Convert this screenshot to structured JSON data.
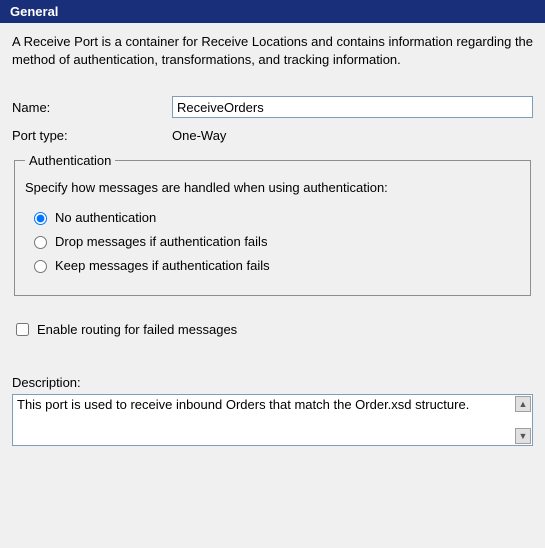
{
  "header": {
    "title": "General"
  },
  "intro": "A Receive Port is a container for Receive Locations and contains information regarding the method of authentication, transformations, and tracking information.",
  "name": {
    "label": "Name:",
    "value": "ReceiveOrders"
  },
  "portType": {
    "label": "Port type:",
    "value": "One-Way"
  },
  "auth": {
    "legend": "Authentication",
    "note": "Specify how messages are handled when using authentication:",
    "options": [
      {
        "label": "No authentication",
        "checked": true
      },
      {
        "label": "Drop messages if authentication fails",
        "checked": false
      },
      {
        "label": "Keep messages if authentication fails",
        "checked": false
      }
    ]
  },
  "routing": {
    "label": "Enable routing for failed messages",
    "checked": false
  },
  "description": {
    "label": "Description:",
    "value": "This port is used to receive inbound Orders that match the Order.xsd structure."
  }
}
